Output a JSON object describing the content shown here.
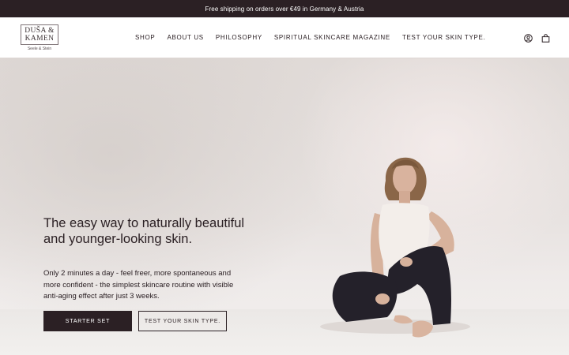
{
  "announcement": {
    "text": "Free shipping on orders over €49 in Germany & Austria"
  },
  "brand": {
    "line1": "DUŠA &",
    "line2": "KAMEN",
    "tagline": "Seele & Stein"
  },
  "nav": {
    "items": [
      {
        "label": "SHOP"
      },
      {
        "label": "ABOUT US"
      },
      {
        "label": "PHILOSOPHY"
      },
      {
        "label": "SPIRITUAL SKINCARE MAGAZINE"
      },
      {
        "label": "TEST YOUR SKIN TYPE."
      }
    ]
  },
  "header_icons": [
    "account-icon",
    "cart-icon"
  ],
  "hero": {
    "title": "The easy way to naturally beautiful and younger-looking skin.",
    "subtitle": "Only 2 minutes a day - feel freer, more spontaneous and more confident - the simplest skincare routine with visible anti-aging effect after just 3 weeks.",
    "primary_button": "STARTER SET",
    "secondary_button": "TEST YOUR SKIN TYPE.",
    "image": "woman-sitting-cross-legged-photo"
  },
  "colors": {
    "dark": "#2b2024",
    "background": "#ece8e6",
    "white": "#ffffff"
  }
}
